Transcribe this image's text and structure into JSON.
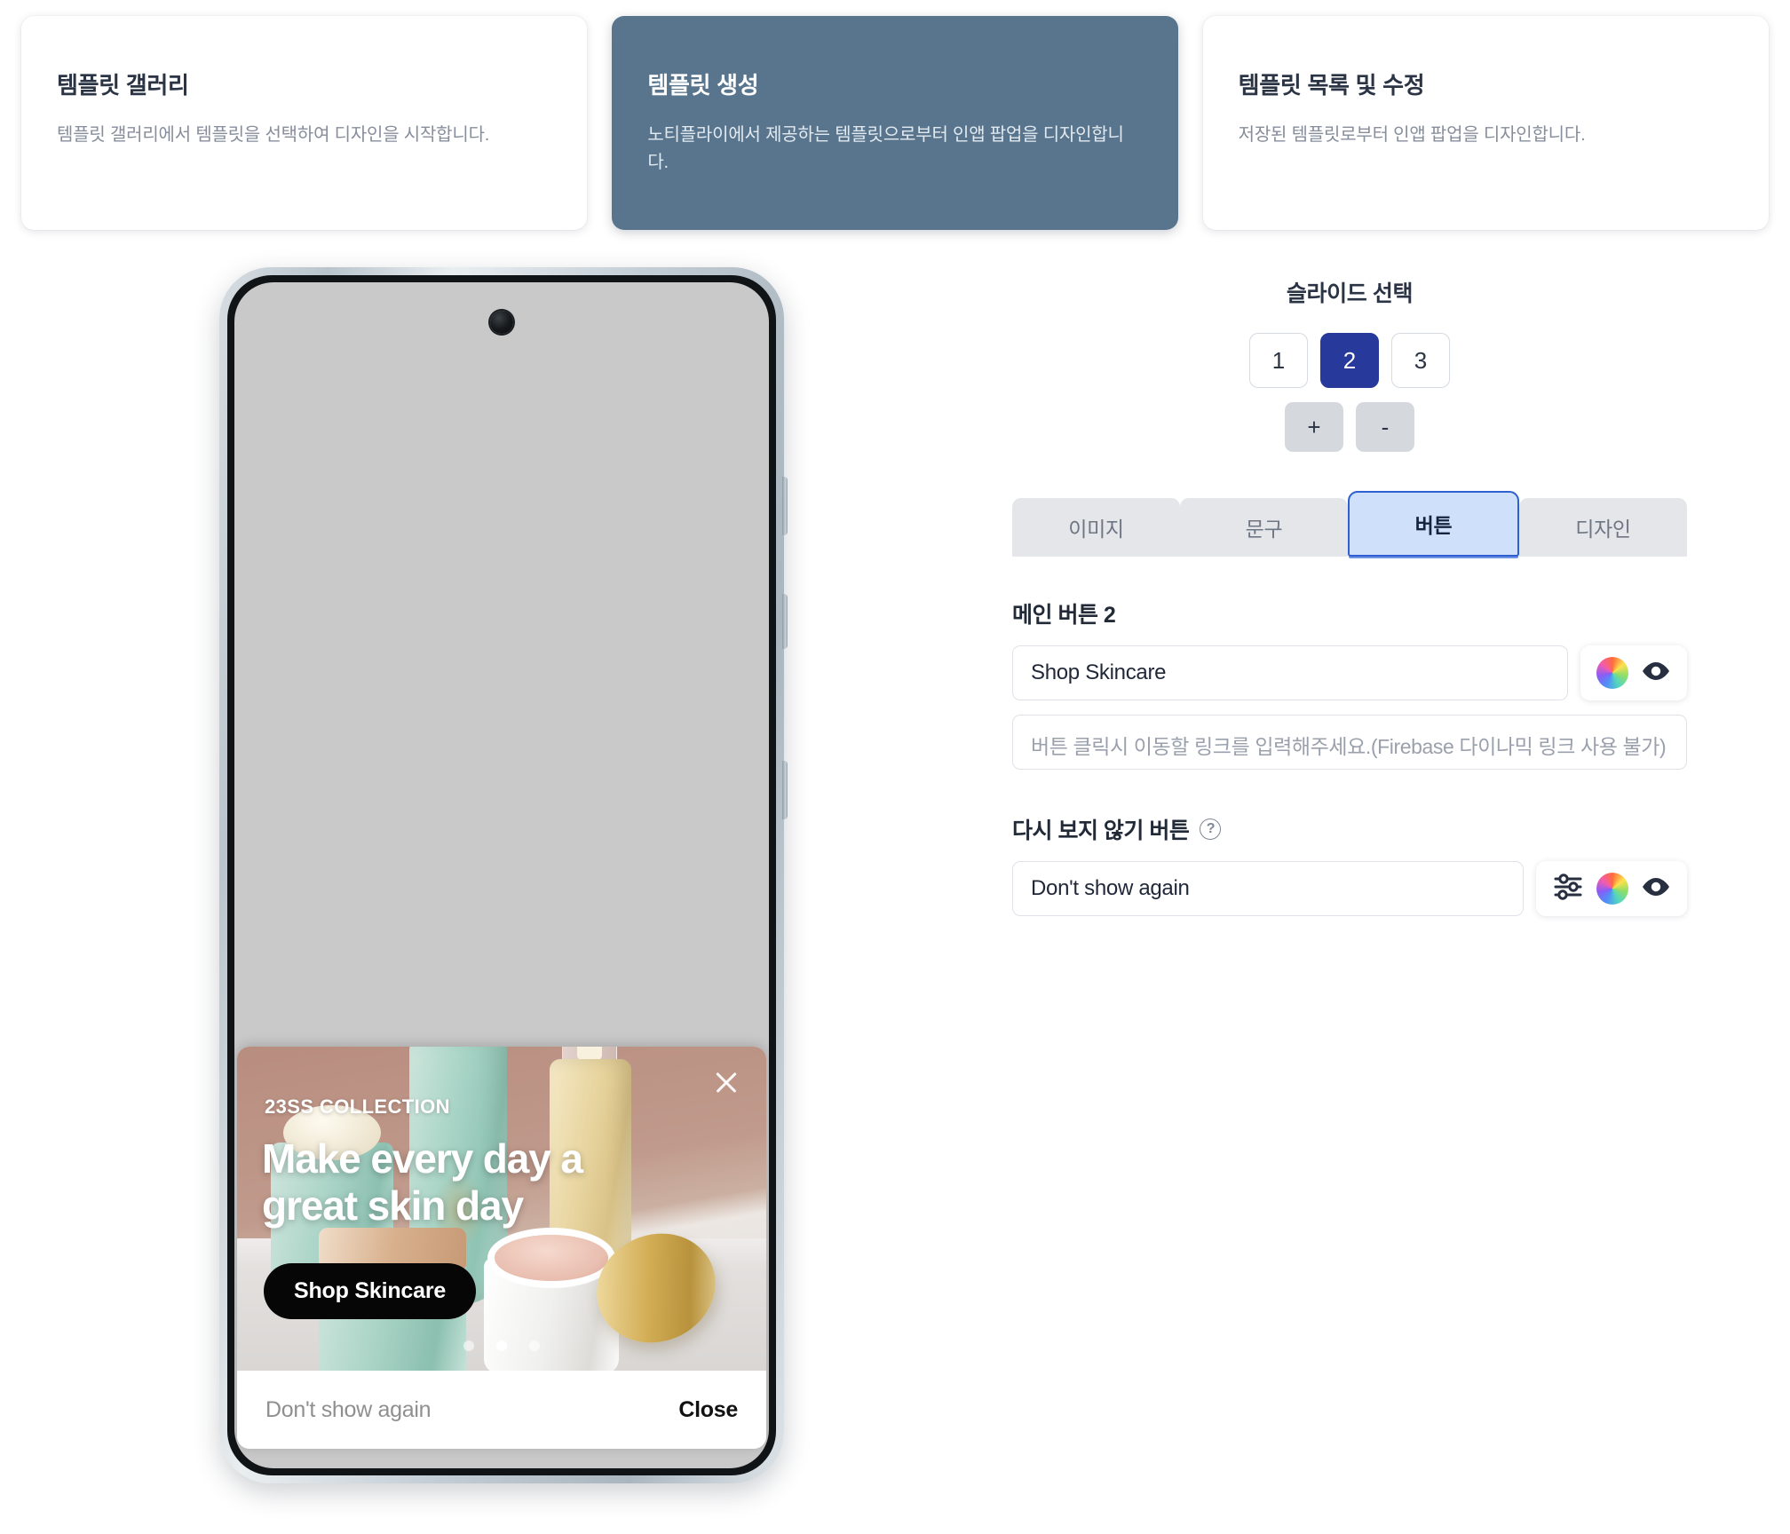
{
  "top_cards": [
    {
      "title": "템플릿 갤러리",
      "desc": "템플릿 갤러리에서 템플릿을 선택하여 디자인을 시작합니다.",
      "selected": false
    },
    {
      "title": "템플릿 생성",
      "desc": "노티플라이에서 제공하는 템플릿으로부터 인앱 팝업을 디자인합니다.",
      "selected": true
    },
    {
      "title": "템플릿 목록 및 수정",
      "desc": "저장된 템플릿로부터 인앱 팝업을 디자인합니다.",
      "selected": false
    }
  ],
  "panel": {
    "heading": "슬라이드 선택",
    "slide_numbers": [
      "1",
      "2",
      "3"
    ],
    "selected_slide": "2",
    "add_label": "+",
    "remove_label": "-",
    "tabs": [
      {
        "label": "이미지",
        "selected": false
      },
      {
        "label": "문구",
        "selected": false
      },
      {
        "label": "버튼",
        "selected": true
      },
      {
        "label": "디자인",
        "selected": false
      }
    ],
    "main_button": {
      "label": "메인 버튼 2",
      "text_value": "Shop Skincare",
      "link_placeholder": "버튼 클릭시 이동할 링크를 입력해주세요.(Firebase 다이나믹 링크 사용 불가)",
      "link_value": "",
      "color_icon": "color-wheel-icon",
      "visibility_icon": "eye-icon"
    },
    "dismiss_button": {
      "label": "다시 보지 않기 버튼",
      "help_icon": "help-circle-icon",
      "help_glyph": "?",
      "text_value": "Don't show again",
      "settings_icon": "sliders-icon",
      "color_icon": "color-wheel-icon",
      "visibility_icon": "eye-icon"
    }
  },
  "preview": {
    "popup": {
      "eyebrow": "23SS COLLECTION",
      "headline": "Make every day a great skin day",
      "cta_label": "Shop Skincare",
      "close_icon": "close-x-icon",
      "carousel_dots": 3,
      "carousel_active_index": 1,
      "footer_left": "Don't show again",
      "footer_right": "Close"
    }
  },
  "colors": {
    "accent_blue": "#27399b",
    "tab_selected_bg": "#cfe0fb",
    "tab_selected_border": "#2f5fd0",
    "card_selected_bg": "#59758e",
    "cta_bg": "#060606",
    "text_dark": "#2b3445",
    "text_muted": "#868e9c"
  }
}
